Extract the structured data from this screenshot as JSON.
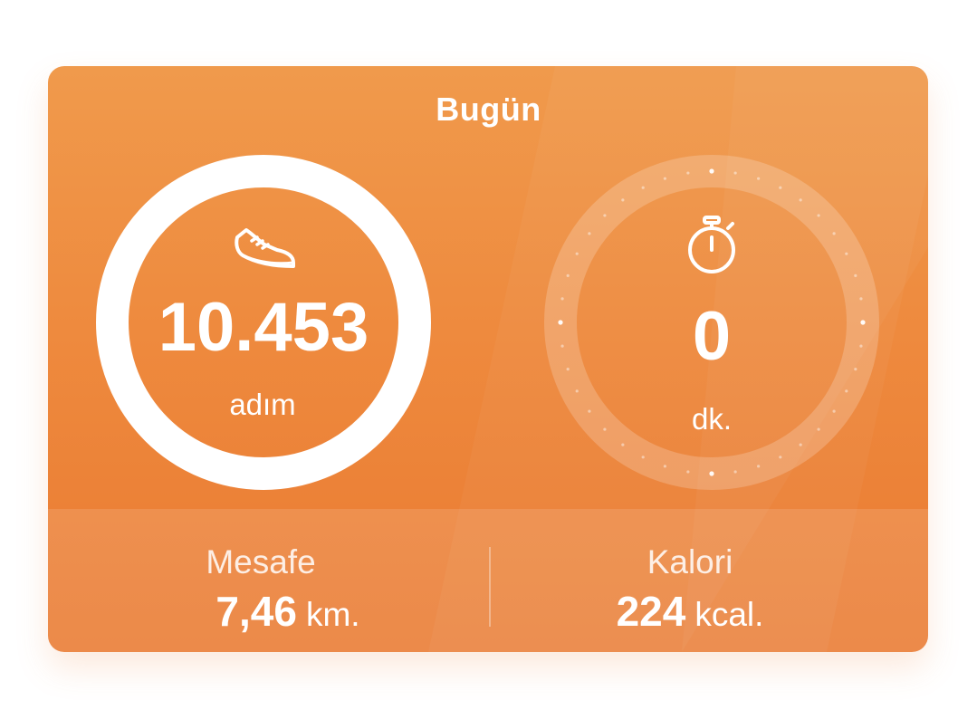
{
  "card": {
    "title": "Bugün",
    "colors": {
      "accent": "#ee8a3e",
      "ring": "#ffffff"
    }
  },
  "steps": {
    "icon": "shoe-icon",
    "value": "10.453",
    "unit": "adım",
    "progress": 1.0
  },
  "activity": {
    "icon": "stopwatch-icon",
    "value": "0",
    "unit": "dk.",
    "progress": 0
  },
  "stats": {
    "distance": {
      "label": "Mesafe",
      "value": "7,46",
      "unit": "km."
    },
    "calories": {
      "label": "Kalori",
      "value": "224",
      "unit": "kcal."
    }
  }
}
